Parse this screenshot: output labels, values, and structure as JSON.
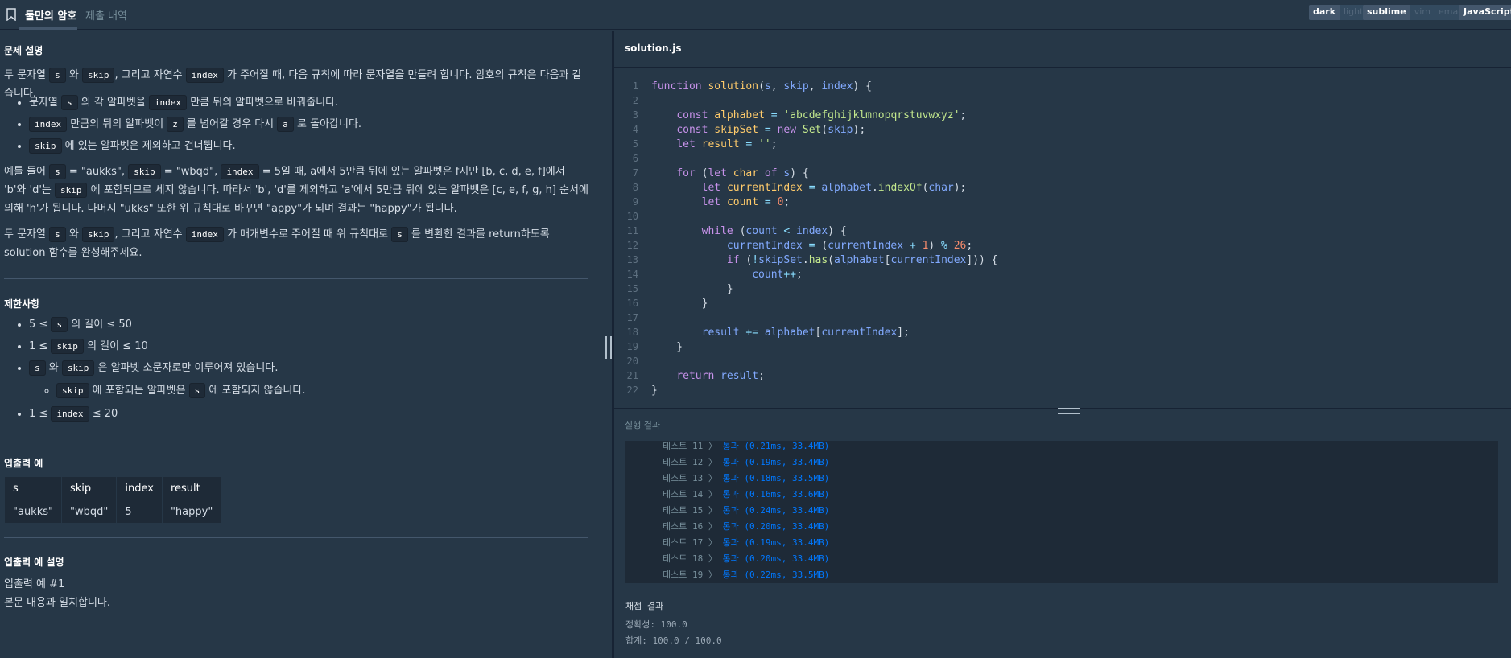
{
  "header": {
    "title": "둘만의 암호",
    "subtab": "제출 내역",
    "theme": [
      "dark",
      "light"
    ],
    "keymap": [
      "sublime",
      "vim",
      "emacs"
    ],
    "language": "JavaScript"
  },
  "problem": {
    "section_title": "문제 설명",
    "intro": {
      "a": "두 문자열 ",
      "s": "s",
      "b": " 와 ",
      "skip": "skip",
      "c": ", 그리고 자연수 ",
      "index": "index",
      "d": " 가 주어질 때, 다음 규칙에 따라 문자열을 만들려 합니다. 암호의 규칙은 다음과 같습니다."
    },
    "rules": [
      {
        "a": "문자열 ",
        "c1": "s",
        "b": " 의 각 알파벳을 ",
        "c2": "index",
        "c": " 만큼 뒤의 알파벳으로 바꿔줍니다."
      },
      {
        "a": "",
        "c1": "index",
        "b": " 만큼의 뒤의 알파벳이 ",
        "c2": "z",
        "c": " 를 넘어갈 경우 다시 ",
        "c3": "a",
        "d": " 로 돌아갑니다."
      },
      {
        "a": "",
        "c1": "skip",
        "b": " 에 있는 알파벳은 제외하고 건너뜁니다."
      }
    ],
    "example": {
      "a": "예를 들어 ",
      "s": "s",
      "b": " = \"aukks\", ",
      "skip": "skip",
      "c": " = \"wbqd\", ",
      "index": "index",
      "d": " = 5일 때, a에서 5만큼 뒤에 있는 알파벳은 f지만 [b, c, d, e, f]에서 'b'와 'd'는 ",
      "skip2": "skip",
      "e": " 에 포함되므로 세지 않습니다. 따라서 'b', 'd'를 제외하고 'a'에서 5만큼 뒤에 있는 알파벳은 [c, e, f, g, h] 순서에 의해 'h'가 됩니다. 나머지 \"ukks\" 또한 위 규칙대로 바꾸면 \"appy\"가 되며 결과는 \"happy\"가 됩니다."
    },
    "task": {
      "a": "두 문자열 ",
      "s": "s",
      "b": " 와 ",
      "skip": "skip",
      "c": ", 그리고 자연수 ",
      "index": "index",
      "d": " 가 매개변수로 주어질 때 위 규칙대로 ",
      "s2": "s",
      "e": " 를 변환한 결과를 return하도록 solution 함수를 완성해주세요."
    }
  },
  "constraints": {
    "title": "제한사항",
    "items": [
      {
        "a": "5 ≤ ",
        "c": "s",
        "b": " 의 길이 ≤ 50"
      },
      {
        "a": "1 ≤ ",
        "c": "skip",
        "b": " 의 길이 ≤ 10"
      },
      {
        "c1": "s",
        "a": " 와 ",
        "c2": "skip",
        "b": " 은 알파벳 소문자로만 이루어져 있습니다."
      },
      {
        "c1": "skip",
        "a": " 에 포함되는 알파벳은 ",
        "c2": "s",
        "b": " 에 포함되지 않습니다."
      },
      {
        "a": "1 ≤ ",
        "c": "index",
        "b": " ≤ 20"
      }
    ]
  },
  "io": {
    "title": "입출력 예",
    "headers": [
      "s",
      "skip",
      "index",
      "result"
    ],
    "row": [
      "\"aukks\"",
      "\"wbqd\"",
      "5",
      "\"happy\""
    ]
  },
  "io_explain": {
    "title": "입출력 예 설명",
    "sub": "입출력 예 #1",
    "text": "본문 내용과 일치합니다."
  },
  "editor": {
    "filename": "solution.js",
    "line_numbers": [
      "1",
      "2",
      "3",
      "4",
      "5",
      "6",
      "7",
      "8",
      "9",
      "10",
      "11",
      "12",
      "13",
      "14",
      "15",
      "16",
      "17",
      "18",
      "19",
      "20",
      "21",
      "22"
    ]
  },
  "results": {
    "title": "실행 결과",
    "lines": [
      {
        "label": "테스트 11 〉",
        "status": "통과 (0.21ms, 33.4MB)"
      },
      {
        "label": "테스트 12 〉",
        "status": "통과 (0.19ms, 33.4MB)"
      },
      {
        "label": "테스트 13 〉",
        "status": "통과 (0.18ms, 33.5MB)"
      },
      {
        "label": "테스트 14 〉",
        "status": "통과 (0.16ms, 33.6MB)"
      },
      {
        "label": "테스트 15 〉",
        "status": "통과 (0.24ms, 33.4MB)"
      },
      {
        "label": "테스트 16 〉",
        "status": "통과 (0.20ms, 33.4MB)"
      },
      {
        "label": "테스트 17 〉",
        "status": "통과 (0.19ms, 33.4MB)"
      },
      {
        "label": "테스트 18 〉",
        "status": "통과 (0.20ms, 33.4MB)"
      },
      {
        "label": "테스트 19 〉",
        "status": "통과 (0.22ms, 33.5MB)"
      }
    ],
    "grading_title": "채점 결과",
    "accuracy": "정확성: 100.0",
    "total": "합계: 100.0 / 100.0"
  }
}
